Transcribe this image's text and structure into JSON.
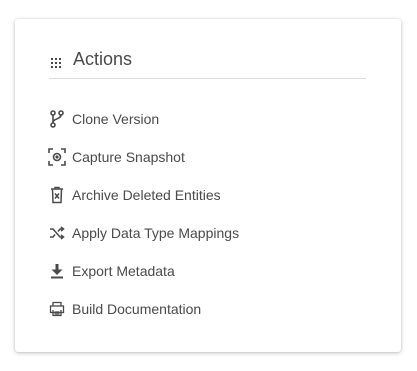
{
  "panel": {
    "title": "Actions",
    "title_icon": "grid-dots-icon"
  },
  "colors": {
    "text": "#4a4a4a",
    "icon": "#4a4a4a",
    "divider": "#dcdcdc"
  },
  "actions": [
    {
      "label": "Clone Version",
      "icon": "branch-icon"
    },
    {
      "label": "Capture Snapshot",
      "icon": "camera-capture-icon"
    },
    {
      "label": "Archive Deleted Entities",
      "icon": "trash-archive-icon"
    },
    {
      "label": "Apply Data Type Mappings",
      "icon": "shuffle-icon"
    },
    {
      "label": "Export Metadata",
      "icon": "download-icon"
    },
    {
      "label": "Build Documentation",
      "icon": "printer-icon"
    }
  ]
}
